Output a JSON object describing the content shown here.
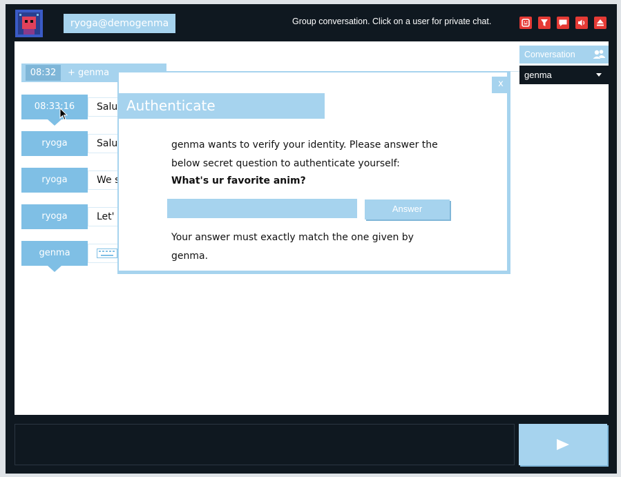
{
  "header": {
    "nickname": "ryoga@demogenma",
    "status_text": "Group conversation. Click on a user for private chat.",
    "icons": [
      "smiley-icon",
      "filter-icon",
      "chat-icon",
      "volume-icon",
      "eject-icon"
    ],
    "button_color": "#e53a35"
  },
  "messages": [
    {
      "who": "08:33:16",
      "text": "Salu"
    },
    {
      "who": "ryoga",
      "text": "Salu"
    },
    {
      "who": "ryoga",
      "text": "We s"
    },
    {
      "who": "ryoga",
      "text": "Let'"
    },
    {
      "who": "genma",
      "text": ""
    }
  ],
  "join": {
    "time": "08:32",
    "text": "+ genma"
  },
  "sidebar": {
    "conversation_label": "Conversation",
    "selected_conversation": "genma"
  },
  "dialog": {
    "title": "Authenticate",
    "close_label": "x",
    "body": "genma wants to verify your identity. Please answer the below secret question to authenticate yourself:",
    "question": "What's ur favorite anim?",
    "answer_label": "Answer",
    "answer_value": "",
    "note": "Your answer must exactly match the one given by genma."
  },
  "composer": {
    "value": ""
  },
  "colors": {
    "accent": "#a6d3ee",
    "accent_dark": "#7fbfe5",
    "background": "#0f1820"
  }
}
